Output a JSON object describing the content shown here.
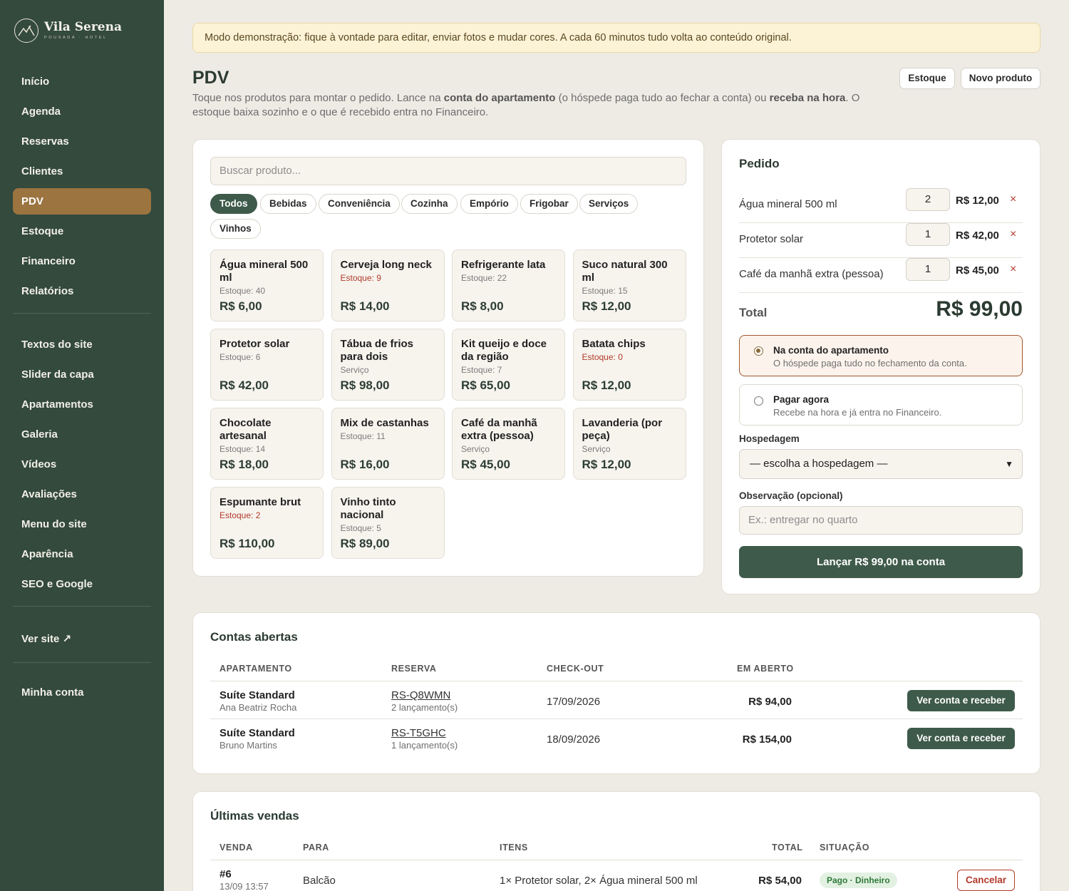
{
  "brand": {
    "name": "Vila Serena",
    "subtitle": "POUSADA · HOTEL"
  },
  "sidebar": {
    "group1": [
      "Início",
      "Agenda",
      "Reservas",
      "Clientes",
      "PDV",
      "Estoque",
      "Financeiro",
      "Relatórios"
    ],
    "group2": [
      "Textos do site",
      "Slider da capa",
      "Apartamentos",
      "Galeria",
      "Vídeos",
      "Avaliações",
      "Menu do site",
      "Aparência",
      "SEO e Google"
    ],
    "view_site": "Ver site ↗",
    "account": "Minha conta",
    "active": "PDV"
  },
  "banner": "Modo demonstração: fique à vontade para editar, enviar fotos e mudar cores. A cada 60 minutos tudo volta ao conteúdo original.",
  "page": {
    "title": "PDV",
    "desc_1": "Toque nos produtos para montar o pedido. Lance na ",
    "desc_b1": "conta do apartamento",
    "desc_2": " (o hóspede paga tudo ao fechar a conta) ou ",
    "desc_b2": "receba na hora",
    "desc_3": ". O estoque baixa sozinho e o que é recebido entra no Financeiro.",
    "btn_stock": "Estoque",
    "btn_new": "Novo produto"
  },
  "products_panel": {
    "search_placeholder": "Buscar produto...",
    "categories": [
      "Todos",
      "Bebidas",
      "Conveniência",
      "Cozinha",
      "Empório",
      "Frigobar",
      "Serviços",
      "Vinhos"
    ],
    "active_category": "Todos",
    "items": [
      {
        "name": "Água mineral 500 ml",
        "stock": "Estoque: 40",
        "low": false,
        "price": "R$ 6,00"
      },
      {
        "name": "Cerveja long neck",
        "stock": "Estoque: 9",
        "low": true,
        "price": "R$ 14,00"
      },
      {
        "name": "Refrigerante lata",
        "stock": "Estoque: 22",
        "low": false,
        "price": "R$ 8,00"
      },
      {
        "name": "Suco natural 300 ml",
        "stock": "Estoque: 15",
        "low": false,
        "price": "R$ 12,00"
      },
      {
        "name": "Protetor solar",
        "stock": "Estoque: 6",
        "low": false,
        "price": "R$ 42,00"
      },
      {
        "name": "Tábua de frios para dois",
        "stock": "Serviço",
        "low": false,
        "price": "R$ 98,00"
      },
      {
        "name": "Kit queijo e doce da região",
        "stock": "Estoque: 7",
        "low": false,
        "price": "R$ 65,00"
      },
      {
        "name": "Batata chips",
        "stock": "Estoque: 0",
        "low": true,
        "price": "R$ 12,00"
      },
      {
        "name": "Chocolate artesanal",
        "stock": "Estoque: 14",
        "low": false,
        "price": "R$ 18,00"
      },
      {
        "name": "Mix de castanhas",
        "stock": "Estoque: 11",
        "low": false,
        "price": "R$ 16,00"
      },
      {
        "name": "Café da manhã extra (pessoa)",
        "stock": "Serviço",
        "low": false,
        "price": "R$ 45,00"
      },
      {
        "name": "Lavanderia (por peça)",
        "stock": "Serviço",
        "low": false,
        "price": "R$ 12,00"
      },
      {
        "name": "Espumante brut",
        "stock": "Estoque: 2",
        "low": true,
        "price": "R$ 110,00"
      },
      {
        "name": "Vinho tinto nacional",
        "stock": "Estoque: 5",
        "low": false,
        "price": "R$ 89,00"
      }
    ]
  },
  "order": {
    "title": "Pedido",
    "lines": [
      {
        "name": "Água mineral 500 ml",
        "qty": "2",
        "price": "R$ 12,00"
      },
      {
        "name": "Protetor solar",
        "qty": "1",
        "price": "R$ 42,00"
      },
      {
        "name": "Café da manhã extra (pessoa)",
        "qty": "1",
        "price": "R$ 45,00"
      }
    ],
    "remove_symbol": "×",
    "total_label": "Total",
    "total_value": "R$ 99,00",
    "option_room_title": "Na conta do apartamento",
    "option_room_sub": "O hóspede paga tudo no fechamento da conta.",
    "option_now_title": "Pagar agora",
    "option_now_sub": "Recebe na hora e já entra no Financeiro.",
    "stay_label": "Hospedagem",
    "stay_value": "— escolha a hospedagem —",
    "note_label": "Observação (opcional)",
    "note_placeholder": "Ex.: entregar no quarto",
    "submit": "Lançar R$ 99,00 na conta"
  },
  "open_accounts": {
    "title": "Contas abertas",
    "headers": [
      "APARTAMENTO",
      "RESERVA",
      "CHECK-OUT",
      "EM ABERTO"
    ],
    "rows": [
      {
        "apt": "Suíte Standard",
        "guest": "Ana Beatriz Rocha",
        "res": "RS-Q8WMN",
        "entries": "2 lançamento(s)",
        "checkout": "17/09/2026",
        "open": "R$ 94,00",
        "action": "Ver conta e receber"
      },
      {
        "apt": "Suíte Standard",
        "guest": "Bruno Martins",
        "res": "RS-T5GHC",
        "entries": "1 lançamento(s)",
        "checkout": "18/09/2026",
        "open": "R$ 154,00",
        "action": "Ver conta e receber"
      }
    ]
  },
  "recent_sales": {
    "title": "Últimas vendas",
    "headers": [
      "VENDA",
      "PARA",
      "ITENS",
      "TOTAL",
      "SITUAÇÃO"
    ],
    "rows": [
      {
        "id": "#6",
        "date": "13/09 13:57",
        "to": "Balcão",
        "items": "1× Protetor solar, 2× Água mineral 500 ml",
        "total": "R$ 54,00",
        "status": "Pago · Dinheiro",
        "action": "Cancelar"
      }
    ]
  },
  "colors": {
    "sidebar": "#334a3d",
    "accent": "#9b7440",
    "primary": "#3e5a4a",
    "danger": "#b23a2a"
  }
}
